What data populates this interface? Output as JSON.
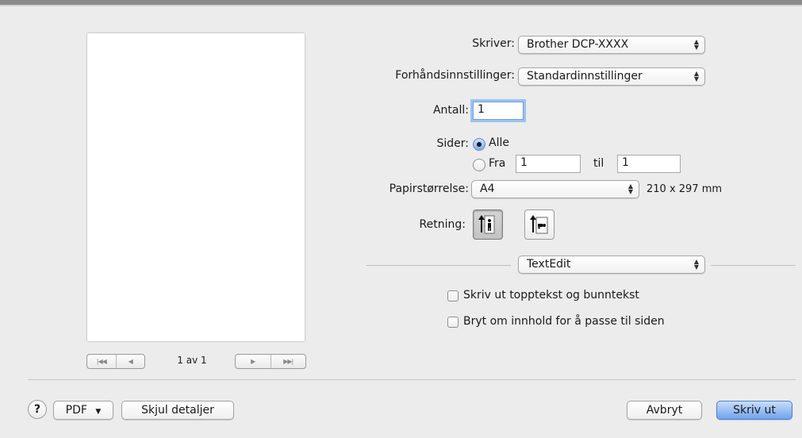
{
  "printer": {
    "label": "Skriver:",
    "value": "Brother DCP-XXXX"
  },
  "presets": {
    "label": "Forhåndsinnstillinger:",
    "value": "Standardinnstillinger"
  },
  "copies": {
    "label": "Antall:",
    "value": "1"
  },
  "pages": {
    "label": "Sider:",
    "all_label": "Alle",
    "from_label": "Fra",
    "from_value": "1",
    "to_label": "til",
    "to_value": "1",
    "selected": "Alle"
  },
  "paper_size": {
    "label": "Papirstørrelse:",
    "value": "A4",
    "dimensions": "210 x 297 mm"
  },
  "orientation": {
    "label": "Retning:",
    "selected": "portrait"
  },
  "section_popup": {
    "value": "TextEdit"
  },
  "options": [
    {
      "label": "Skriv ut topptekst og bunntekst",
      "checked": false
    },
    {
      "label": "Bryt om innhold for å passe til siden",
      "checked": false
    }
  ],
  "preview": {
    "page_indicator": "1 av 1"
  },
  "footer": {
    "help": "?",
    "pdf_label": "PDF",
    "hide_details": "Skjul detaljer",
    "cancel": "Avbryt",
    "print": "Skriv ut"
  },
  "icons": {
    "popup_arrows": "up-down-chevron-icon",
    "first_page": "first-page-icon",
    "prev_page": "prev-page-icon",
    "next_page": "next-page-icon",
    "last_page": "last-page-icon",
    "portrait": "portrait-orientation-icon",
    "landscape": "landscape-orientation-icon"
  },
  "colors": {
    "accent": "#6fa2ee",
    "background": "#ececec"
  }
}
